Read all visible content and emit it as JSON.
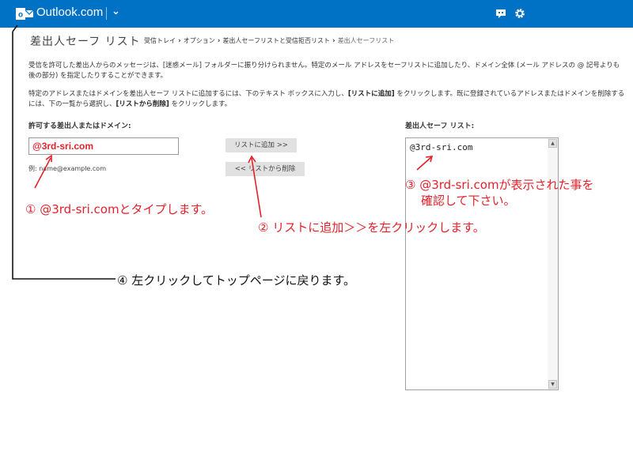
{
  "app": {
    "name": "Outlook.com"
  },
  "icons": {
    "logo": "outlook-logo",
    "menu": "chevron-down-icon",
    "messenger": "chat-icon",
    "settings": "gear-icon"
  },
  "colors": {
    "topbar": "#0072c6",
    "annotation": "#e6212a",
    "button": "#e1e1e1"
  },
  "page": {
    "title": "差出人セーフ リスト",
    "breadcrumb": [
      "受信トレイ",
      "オプション",
      "差出人セーフリストと受信拒否リスト",
      "差出人セーフリスト"
    ]
  },
  "description": {
    "p1": "受信を許可した差出人からのメッセージは、[迷惑メール] フォルダーに振り分けられません。特定のメール アドレスをセーフリストに追加したり、ドメイン全体 (メール アドレスの @ 記号よりも後の部分) を指定したりすることができます。",
    "p2_a": "特定のアドレスまたはドメインを差出人セーフ リストに追加するには、下のテキスト ボックスに入力し、",
    "p2_b": "[リストに追加]",
    "p2_c": " をクリックします。既に登録されているアドレスまたはドメインを削除するには、下の一覧から選択し、",
    "p2_d": "[リストから削除]",
    "p2_e": " をクリックします。"
  },
  "form": {
    "allow_label": "許可する差出人またはドメイン:",
    "input_value": "@3rd-sri.com",
    "example": "例: name@example.com",
    "add_button": "リストに追加 >>",
    "remove_button": "<< リストから削除"
  },
  "safe_list": {
    "label": "差出人セーフ リスト:",
    "items": [
      "@3rd-sri.com"
    ]
  },
  "annotations": {
    "step1": "① @3rd-sri.comとタイプします。",
    "step2": "② リストに追加＞＞を左クリックします。",
    "step3_line1": "③ @3rd-sri.comが表示された事を",
    "step3_line2": "確認して下さい。",
    "step4": "④ 左クリックしてトップページに戻ります。"
  }
}
